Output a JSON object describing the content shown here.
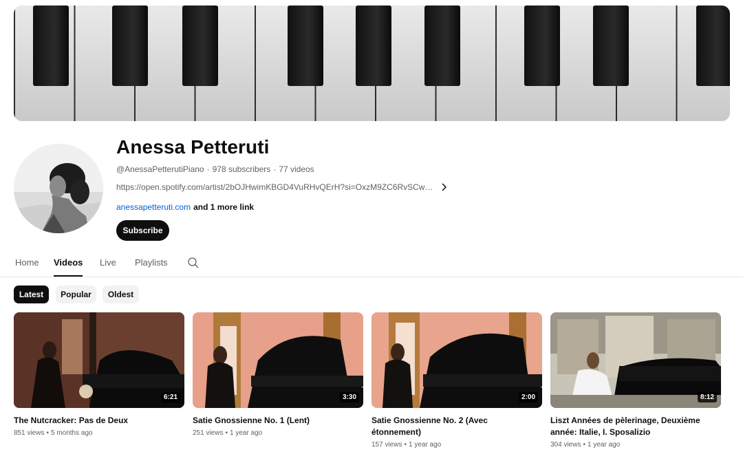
{
  "channel": {
    "name": "Anessa Petteruti",
    "handle": "@AnessaPetterutiPiano",
    "subscribers": "978 subscribers",
    "video_count": "77 videos",
    "separator": "·",
    "description": "https://open.spotify.com/artist/2bOJHwimKBGD4VuRHvQErH?si=OxzM9ZC6RvSCwiCZQu...",
    "link_text": "anessapetteruti.com",
    "more_links": "and 1 more link",
    "subscribe_label": "Subscribe"
  },
  "tabs": [
    {
      "label": "Home",
      "active": false
    },
    {
      "label": "Videos",
      "active": true
    },
    {
      "label": "Live",
      "active": false
    },
    {
      "label": "Playlists",
      "active": false
    }
  ],
  "chips": [
    {
      "label": "Latest",
      "active": true
    },
    {
      "label": "Popular",
      "active": false
    },
    {
      "label": "Oldest",
      "active": false
    }
  ],
  "videos": [
    {
      "title": "The Nutcracker: Pas de Deux",
      "duration": "6:21",
      "views": "851 views",
      "age": "5 months ago"
    },
    {
      "title": "Satie Gnossienne No. 1 (Lent)",
      "duration": "3:30",
      "views": "251 views",
      "age": "1 year ago"
    },
    {
      "title": "Satie Gnossienne No. 2 (Avec étonnement)",
      "duration": "2:00",
      "views": "157 views",
      "age": "1 year ago"
    },
    {
      "title": "Liszt Années de pèlerinage, Deuxième année: Italie, I. Sposalizio",
      "duration": "8:12",
      "views": "304 views",
      "age": "1 year ago"
    }
  ],
  "meta_dot": "•",
  "icons": {
    "search": "search-icon",
    "chevron": "chevron-right-icon"
  },
  "colors": {
    "link": "#065fd4",
    "subscribe_bg": "#0f0f0f",
    "secondary_text": "#606060"
  }
}
